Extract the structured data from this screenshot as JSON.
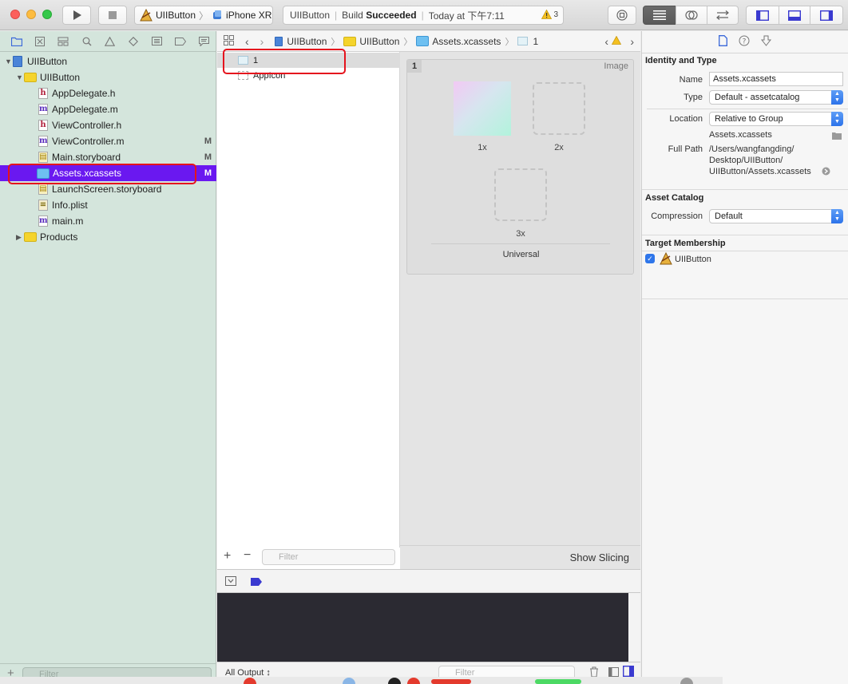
{
  "toolbar": {
    "scheme_target": "UIIButton",
    "scheme_device": "iPhone XR",
    "status_project": "UIIButton",
    "status_build": "Build",
    "status_result": "Succeeded",
    "status_time": "Today at 下午7:11",
    "warning_count": "3"
  },
  "navigator": {
    "items": [
      {
        "label": "UIIButton",
        "kind": "project"
      },
      {
        "label": "UIIButton",
        "kind": "folder"
      },
      {
        "label": "AppDelegate.h",
        "kind": "h"
      },
      {
        "label": "AppDelegate.m",
        "kind": "m"
      },
      {
        "label": "ViewController.h",
        "kind": "h"
      },
      {
        "label": "ViewController.m",
        "kind": "m",
        "flag": "M"
      },
      {
        "label": "Main.storyboard",
        "kind": "storyboard",
        "flag": "M"
      },
      {
        "label": "Assets.xcassets",
        "kind": "xcassets",
        "flag": "M",
        "selected": true
      },
      {
        "label": "LaunchScreen.storyboard",
        "kind": "storyboard"
      },
      {
        "label": "Info.plist",
        "kind": "plist"
      },
      {
        "label": "main.m",
        "kind": "m"
      },
      {
        "label": "Products",
        "kind": "folder"
      }
    ],
    "filter_placeholder": "Filter"
  },
  "jumpbar": {
    "crumbs": [
      "UIIButton",
      "UIIButton",
      "Assets.xcassets",
      "1"
    ]
  },
  "assets": {
    "items": [
      "1",
      "AppIcon"
    ],
    "filter_placeholder": "Filter"
  },
  "editor": {
    "set_name": "1",
    "set_kind": "Image",
    "slots": [
      "1x",
      "2x",
      "3x"
    ],
    "idiom": "Universal",
    "show_slicing": "Show Slicing"
  },
  "debug": {
    "output_selector": "All Output ↕",
    "filter_placeholder": "Filter"
  },
  "inspector": {
    "identity_title": "Identity and Type",
    "name_label": "Name",
    "name_value": "Assets.xcassets",
    "type_label": "Type",
    "type_value": "Default - assetcatalog",
    "location_label": "Location",
    "location_value": "Relative to Group",
    "location_file": "Assets.xcassets",
    "fullpath_label": "Full Path",
    "fullpath_line1": "/Users/wangfangding/",
    "fullpath_line2": "Desktop/UIIButton/",
    "fullpath_line3": "UIIButton/Assets.xcassets",
    "catalog_title": "Asset Catalog",
    "compression_label": "Compression",
    "compression_value": "Default",
    "membership_title": "Target Membership",
    "membership_target": "UIIButton"
  },
  "colors": {
    "selection": "#6a18f0",
    "highlight_box": "#e5131d",
    "navigator_bg": "#d4e5dc",
    "console_bg": "#2b2a32"
  }
}
